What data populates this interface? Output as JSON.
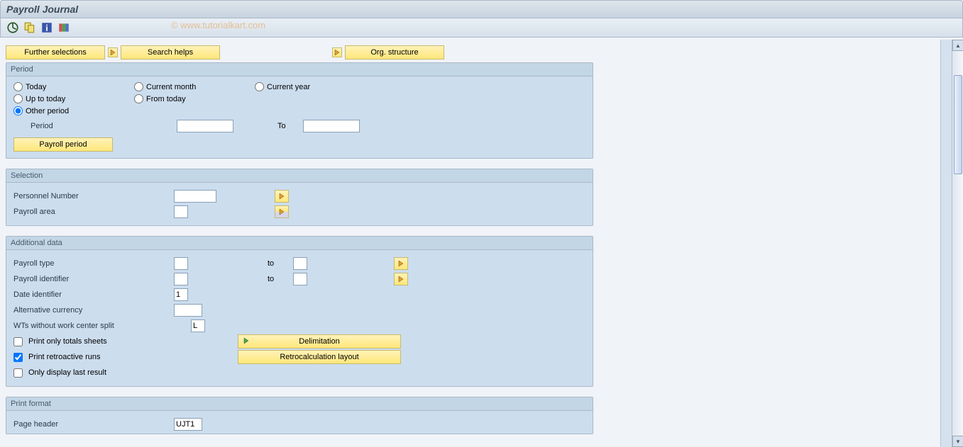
{
  "title": "Payroll Journal",
  "watermark": "© www.tutorialkart.com",
  "topButtons": {
    "further": "Further selections",
    "search": "Search helps",
    "org": "Org. structure"
  },
  "period": {
    "legend": "Period",
    "today": "Today",
    "uptoToday": "Up to today",
    "other": "Other period",
    "currentMonth": "Current month",
    "fromToday": "From today",
    "currentYear": "Current year",
    "periodLbl": "Period",
    "to": "To",
    "periodFrom": "",
    "periodTo": "",
    "payrollPeriod": "Payroll period"
  },
  "selection": {
    "legend": "Selection",
    "personnel": "Personnel Number",
    "personnelVal": "",
    "area": "Payroll area",
    "areaVal": ""
  },
  "additional": {
    "legend": "Additional data",
    "ptype": "Payroll type",
    "pident": "Payroll identifier",
    "dident": "Date identifier",
    "didentVal": "1",
    "altcurr": "Alternative currency",
    "altcurrVal": "",
    "wts": "WTs without work center split",
    "wtsVal": "L",
    "to": "to",
    "chkTotals": "Print only totals sheets",
    "chkRetro": "Print retroactive runs",
    "chkLast": "Only display last result",
    "delim": "Delimitation",
    "retro": "Retrocalculation layout"
  },
  "printformat": {
    "legend": "Print format",
    "pageheader": "Page header",
    "pageheaderVal": "UJT1"
  }
}
